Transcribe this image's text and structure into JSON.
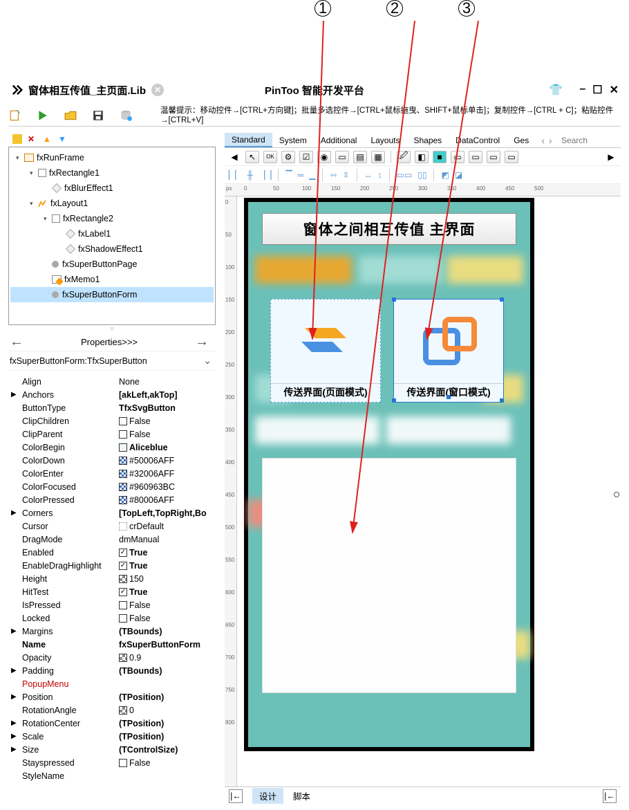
{
  "annotations": [
    "1",
    "2",
    "3"
  ],
  "titlebar": {
    "doc": "窗体相互传值_主页面.Lib",
    "app": "PinToo 智能开发平台",
    "minimize": "–",
    "restore": "☐",
    "close": "✕"
  },
  "hint": "温馨提示：移动控件→[CTRL+方向键]；批量多选控件→[CTRL+鼠标拖曳、SHIFT+鼠标单击]；复制控件→[CTRL + C]；粘贴控件→[CTRL+V]",
  "tree": {
    "nodes": [
      {
        "depth": 0,
        "exp": "▾",
        "icon": "frame",
        "label": "fxRunFrame"
      },
      {
        "depth": 1,
        "exp": "▾",
        "icon": "sq",
        "label": "fxRectangle1"
      },
      {
        "depth": 2,
        "exp": "",
        "icon": "diamond",
        "label": "fxBlurEffect1"
      },
      {
        "depth": 1,
        "exp": "▾",
        "icon": "layout",
        "label": "fxLayout1"
      },
      {
        "depth": 2,
        "exp": "▾",
        "icon": "sq",
        "label": "fxRectangle2"
      },
      {
        "depth": 3,
        "exp": "",
        "icon": "diamond",
        "label": "fxLabel1"
      },
      {
        "depth": 3,
        "exp": "",
        "icon": "diamond",
        "label": "fxShadowEffect1"
      },
      {
        "depth": 2,
        "exp": "",
        "icon": "circ",
        "label": "fxSuperButtonPage"
      },
      {
        "depth": 2,
        "exp": "",
        "icon": "memo",
        "label": "fxMemo1"
      },
      {
        "depth": 2,
        "exp": "",
        "icon": "circ",
        "label": "fxSuperButtonForm",
        "selected": true
      }
    ]
  },
  "propHeader": {
    "label": "Properties>>>",
    "left": "←",
    "right": "→"
  },
  "classRow": "fxSuperButtonForm:TfxSuperButton",
  "props": [
    {
      "e": "",
      "n": "Align",
      "v": "None"
    },
    {
      "e": "▶",
      "n": "Anchors",
      "v": "[akLeft,akTop]",
      "bold": true
    },
    {
      "e": "",
      "n": "ButtonType",
      "v": "TfxSvgButton",
      "bold": true
    },
    {
      "e": "",
      "n": "ClipChildren",
      "v": "False",
      "ctrl": "chk"
    },
    {
      "e": "",
      "n": "ClipParent",
      "v": "False",
      "ctrl": "chk"
    },
    {
      "e": "",
      "n": "ColorBegin",
      "v": "Aliceblue",
      "bold": true,
      "sw": "#f0f8ff"
    },
    {
      "e": "",
      "n": "ColorDown",
      "v": "#50006AFF",
      "sw": "checker"
    },
    {
      "e": "",
      "n": "ColorEnter",
      "v": "#32006AFF",
      "sw": "checker"
    },
    {
      "e": "",
      "n": "ColorFocused",
      "v": "#960963BC",
      "sw": "checker"
    },
    {
      "e": "",
      "n": "ColorPressed",
      "v": "#80006AFF",
      "sw": "checker"
    },
    {
      "e": "▶",
      "n": "Corners",
      "v": "[TopLeft,TopRight,Bo",
      "bold": true
    },
    {
      "e": "",
      "n": "Cursor",
      "v": "crDefault",
      "ctrl": "cur"
    },
    {
      "e": "",
      "n": "DragMode",
      "v": "dmManual"
    },
    {
      "e": "",
      "n": "Enabled",
      "v": "True",
      "bold": true,
      "ctrl": "chked"
    },
    {
      "e": "",
      "n": "EnableDragHighlight",
      "v": "True",
      "bold": true,
      "ctrl": "chked"
    },
    {
      "e": "",
      "n": "Height",
      "v": "150",
      "ctrl": "spin"
    },
    {
      "e": "",
      "n": "HitTest",
      "v": "True",
      "bold": true,
      "ctrl": "chked"
    },
    {
      "e": "",
      "n": "IsPressed",
      "v": "False",
      "ctrl": "chk"
    },
    {
      "e": "",
      "n": "Locked",
      "v": "False",
      "ctrl": "chk"
    },
    {
      "e": "▶",
      "n": "Margins",
      "v": "(TBounds)",
      "bold": true
    },
    {
      "e": "",
      "n": "Name",
      "v": "fxSuperButtonForm",
      "bold": true,
      "nbold": true
    },
    {
      "e": "",
      "n": "Opacity",
      "v": "0.9",
      "ctrl": "spin"
    },
    {
      "e": "▶",
      "n": "Padding",
      "v": "(TBounds)",
      "bold": true
    },
    {
      "e": "",
      "n": "PopupMenu",
      "v": "",
      "red": true
    },
    {
      "e": "▶",
      "n": "Position",
      "v": "(TPosition)",
      "bold": true
    },
    {
      "e": "",
      "n": "RotationAngle",
      "v": "0",
      "ctrl": "spin"
    },
    {
      "e": "▶",
      "n": "RotationCenter",
      "v": "(TPosition)",
      "bold": true
    },
    {
      "e": "▶",
      "n": "Scale",
      "v": "(TPosition)",
      "bold": true
    },
    {
      "e": "▶",
      "n": "Size",
      "v": "(TControlSize)",
      "bold": true
    },
    {
      "e": "",
      "n": "Stayspressed",
      "v": "False",
      "ctrl": "chk"
    },
    {
      "e": "",
      "n": "StyleName",
      "v": ""
    }
  ],
  "tabs": {
    "items": [
      "Standard",
      "System",
      "Additional",
      "Layouts",
      "Shapes",
      "DataControl",
      "Ges"
    ],
    "active": 0,
    "searchPlaceholder": "Search"
  },
  "rulerH": [
    "0",
    "50",
    "100",
    "150",
    "200",
    "250",
    "300",
    "350",
    "400",
    "450",
    "500"
  ],
  "rulerV": [
    "0",
    "50",
    "100",
    "150",
    "200",
    "250",
    "300",
    "350",
    "400",
    "450",
    "500",
    "550",
    "600",
    "650",
    "700",
    "750",
    "800"
  ],
  "pxLabel": "px",
  "design": {
    "title": "窗体之间相互传值 主界面",
    "btn1": "传送界面(页面模式)",
    "btn2": "传送界面(窗口模式)"
  },
  "status": {
    "design": "设计",
    "script": "脚本"
  }
}
